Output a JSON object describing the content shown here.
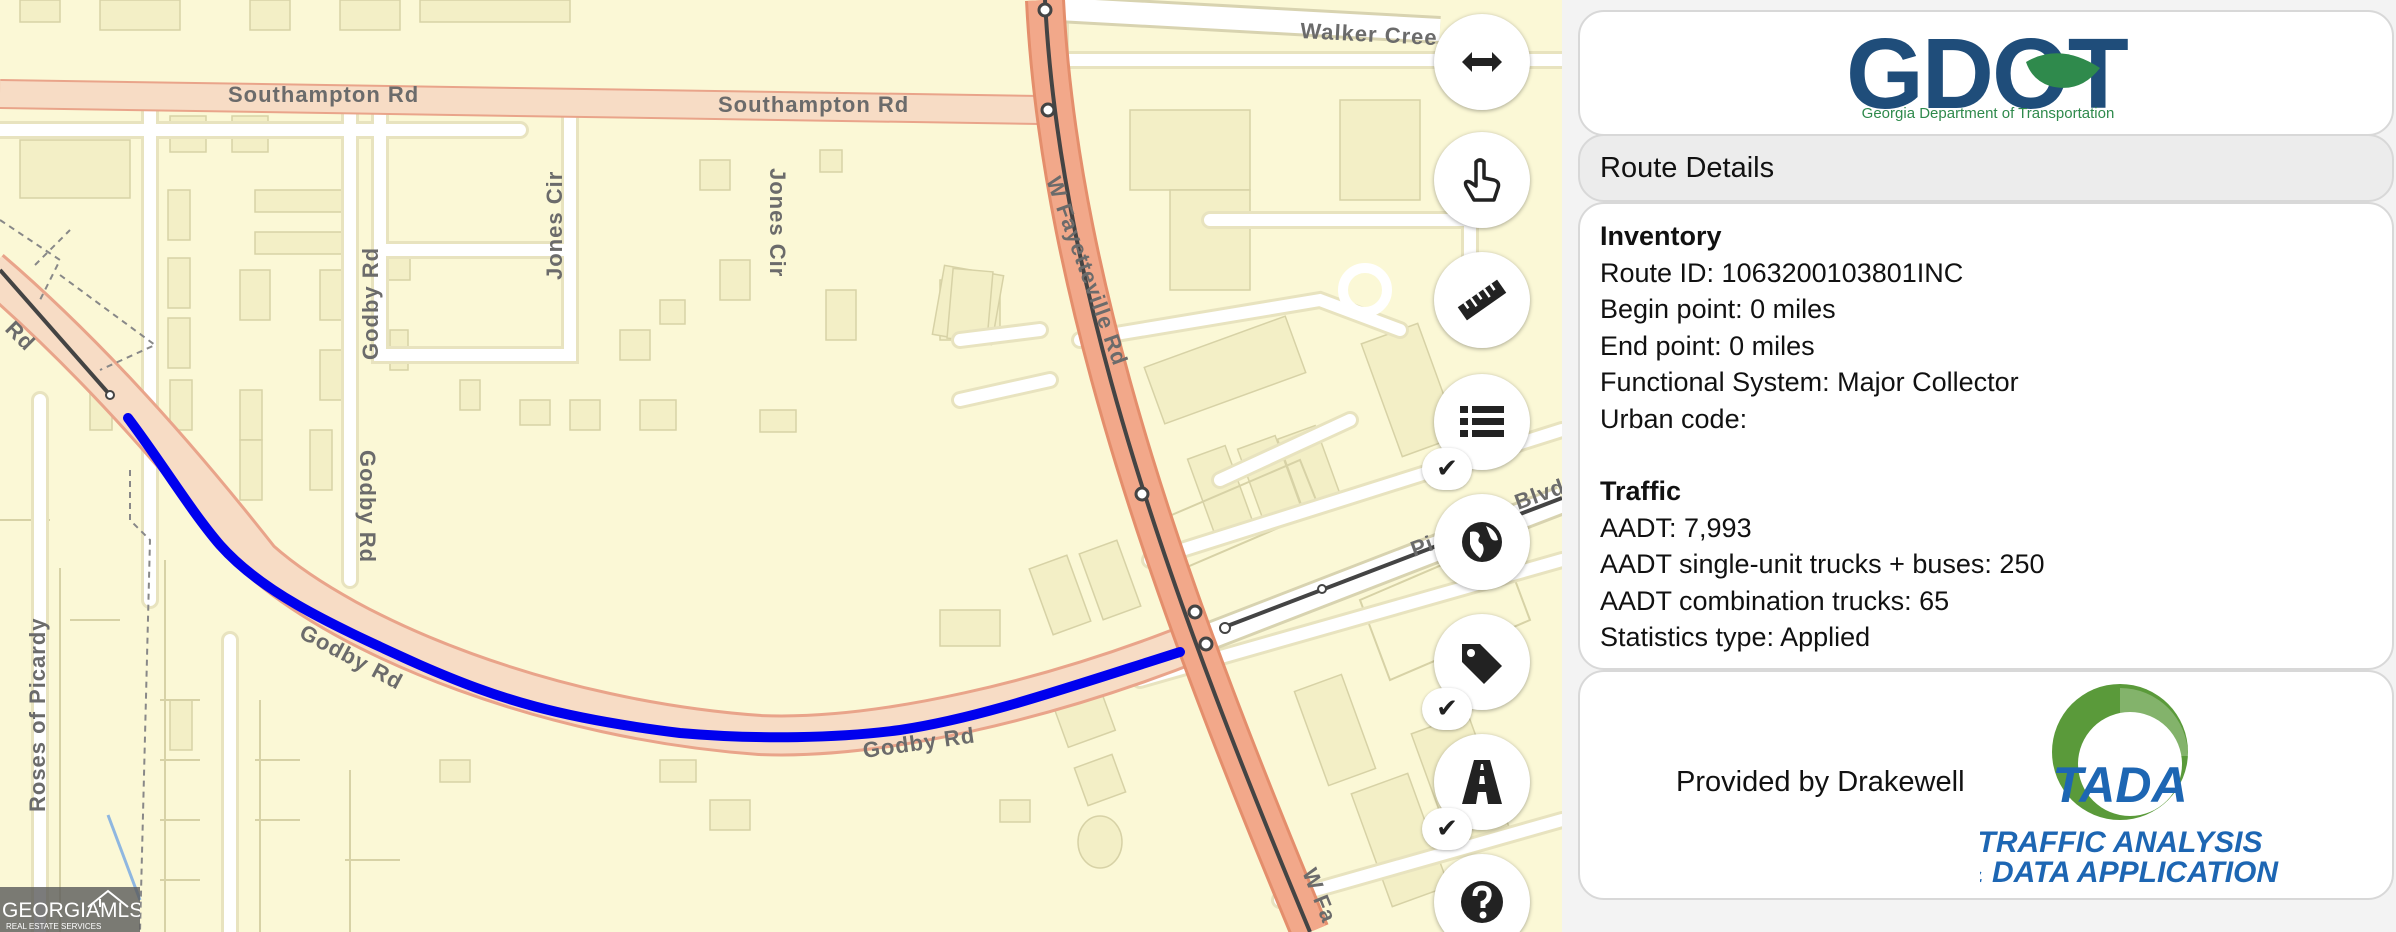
{
  "map": {
    "road_labels": {
      "southampton_1": "Southampton Rd",
      "southampton_2": "Southampton Rd",
      "walker": "Walker Cree",
      "jones_1": "Jones Cir",
      "jones_2": "Jones Cir",
      "godby_1": "Godby Rd",
      "godby_2": "Godby Rd",
      "godby_3": "Godby Rd",
      "godby_4": "Godby Rd",
      "fayetteville": "W Fayetteville Rd",
      "fayetteville_2": "W Fa",
      "roses": "Roses of Picardy",
      "rd_left": "Rd",
      "pi": "Pi",
      "blvd": "Blvd"
    },
    "colors": {
      "land": "#fbf8d6",
      "route": "#0000ee",
      "arterial": "#f2a88a"
    }
  },
  "tools": [
    {
      "name": "pan-extent",
      "icon": "double-arrow-icon"
    },
    {
      "name": "select",
      "icon": "pointing-hand-icon"
    },
    {
      "name": "measure",
      "icon": "ruler-icon"
    },
    {
      "name": "layers-list",
      "icon": "list-icon",
      "checked": true
    },
    {
      "name": "basemap",
      "icon": "globe-icon"
    },
    {
      "name": "labels",
      "icon": "tag-icon",
      "checked": true
    },
    {
      "name": "roads",
      "icon": "road-icon",
      "checked": true
    },
    {
      "name": "help",
      "icon": "question-icon"
    }
  ],
  "check_mark": "✔",
  "panel": {
    "logo": {
      "text": "GDOT",
      "subtitle": "Georgia Department of Transportation",
      "color": "#1f4d7a",
      "accent": "#2f8a4c"
    },
    "section_title": "Route Details",
    "inventory": {
      "heading": "Inventory",
      "route_id": "Route ID: 1063200103801INC",
      "begin": "Begin point: 0 miles",
      "end": "End point: 0 miles",
      "functional": "Functional System: Major Collector",
      "urban": "Urban code:"
    },
    "traffic": {
      "heading": "Traffic",
      "aadt": "AADT: 7,993",
      "single_unit": "AADT single-unit trucks + buses: 250",
      "combination": "AADT combination trucks: 65",
      "stats_type": "Statistics type: Applied"
    },
    "provided_by": "Provided by Drakewell",
    "tada": {
      "name": "TADA",
      "line1": "TRAFFIC ANALYSIS",
      "line2": "& DATA APPLICATION",
      "color": "#1d66b3",
      "green": "#5a9a3a"
    }
  },
  "watermark": {
    "text": "GEORGIAMLS",
    "sub": "REAL ESTATE SERVICES"
  }
}
